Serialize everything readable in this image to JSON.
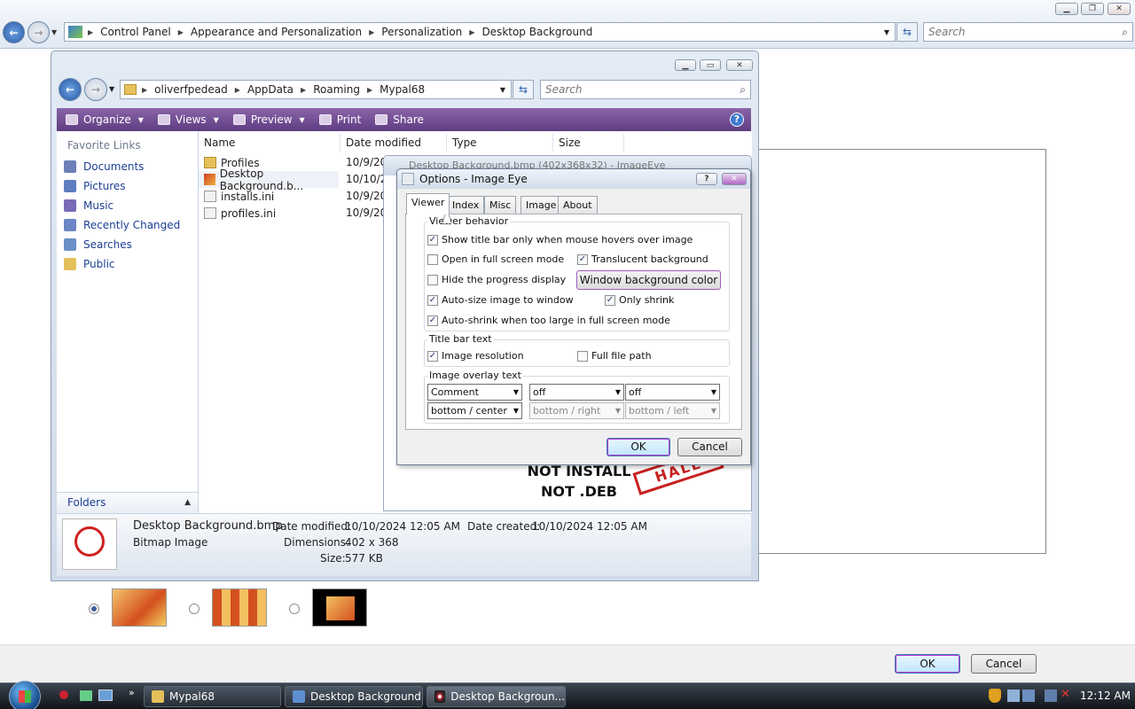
{
  "control_panel": {
    "breadcrumb": [
      "Control Panel",
      "Appearance and Personalization",
      "Personalization",
      "Desktop Background"
    ],
    "search_placeholder": "Search",
    "ok_label": "OK",
    "cancel_label": "Cancel",
    "positions": [
      "fill",
      "tile",
      "center"
    ],
    "selected_position": 0
  },
  "explorer": {
    "breadcrumb": [
      "oliverfpedead",
      "AppData",
      "Roaming",
      "Mypal68"
    ],
    "search_placeholder": "Search",
    "toolbar": [
      "Organize",
      "Views",
      "Preview",
      "Print",
      "Share"
    ],
    "favorites_heading": "Favorite Links",
    "favorites": [
      "Documents",
      "Pictures",
      "Music",
      "Recently Changed",
      "Searches",
      "Public"
    ],
    "folders_label": "Folders",
    "columns": [
      "Name",
      "Date modified",
      "Type",
      "Size"
    ],
    "files": [
      {
        "name": "Profiles",
        "date": "10/9/20",
        "icon": "folder-icon"
      },
      {
        "name": "Desktop Background.b...",
        "date": "10/10/20",
        "icon": "bitmap-icon"
      },
      {
        "name": "installs.ini",
        "date": "10/9/20",
        "icon": "ini-file-icon"
      },
      {
        "name": "profiles.ini",
        "date": "10/9/20",
        "icon": "ini-file-icon"
      }
    ],
    "details": {
      "filename": "Desktop Background.bmp",
      "filetype": "Bitmap Image",
      "date_modified_label": "Date modified:",
      "date_modified": "10/10/2024 12:05 AM",
      "date_created_label": "Date created:",
      "date_created": "10/10/2024 12:05 AM",
      "dimensions_label": "Dimensions:",
      "dimensions": "402 x 368",
      "size_label": "Size:",
      "size": "577 KB"
    }
  },
  "image_eye": {
    "title": "Desktop Background.bmp (402x368x32) - ImageEye",
    "image_text_1": "NOT INSTALL",
    "image_text_2": "NOT .DEB",
    "stamp_text": "HALL"
  },
  "options_dialog": {
    "title": "Options - Image Eye",
    "help_label": "?",
    "tabs": [
      "Viewer",
      "Index",
      "Misc",
      "Image",
      "About"
    ],
    "active_tab": "Viewer",
    "viewer_behavior": {
      "label": "Viewer behavior",
      "show_title_bar": {
        "label": "Show title bar only when mouse hovers over image",
        "checked": true
      },
      "full_screen": {
        "label": "Open in full screen mode",
        "checked": false
      },
      "translucent": {
        "label": "Translucent background",
        "checked": true
      },
      "hide_progress": {
        "label": "Hide the progress display",
        "checked": false
      },
      "window_bg_button": "Window background color",
      "auto_size": {
        "label": "Auto-size image to window",
        "checked": true
      },
      "only_shrink": {
        "label": "Only shrink",
        "checked": true
      },
      "auto_shrink": {
        "label": "Auto-shrink when too large in full screen mode",
        "checked": true
      }
    },
    "title_bar_text": {
      "label": "Title bar text",
      "image_resolution": {
        "label": "Image resolution",
        "checked": true
      },
      "full_file_path": {
        "label": "Full file path",
        "checked": false
      }
    },
    "overlay": {
      "label": "Image overlay text",
      "selects": [
        "Comment",
        "off",
        "off"
      ],
      "positions": [
        "bottom / center",
        "bottom / right",
        "bottom / left"
      ]
    },
    "ok_label": "OK",
    "cancel_label": "Cancel"
  },
  "taskbar": {
    "items": [
      "Mypal68",
      "Desktop Background",
      "Desktop Backgroun..."
    ],
    "clock": "12:12 AM"
  },
  "colors": {
    "toolbar_purple": "#6b4690",
    "link_blue": "#1c3f94",
    "accent_dialog": "#b33bd6"
  }
}
